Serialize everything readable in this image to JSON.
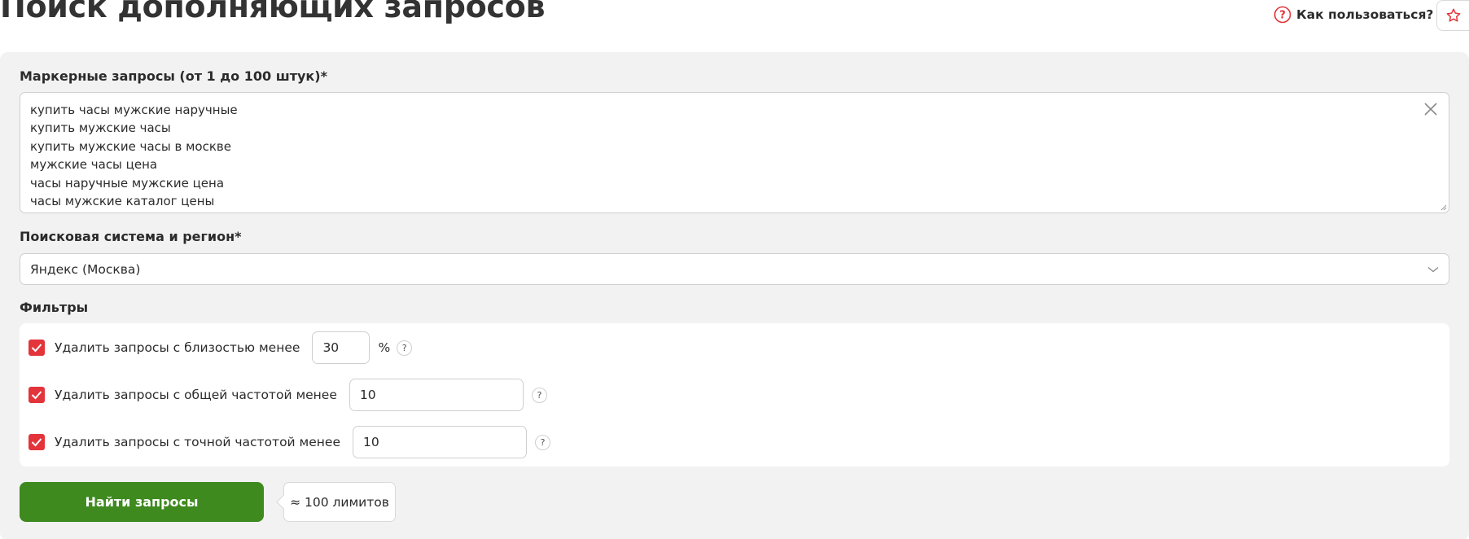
{
  "header": {
    "title": "Поиск дополняющих запросов",
    "help_label": "Как пользоваться?",
    "help_icon": "question-circle-icon",
    "favorite_icon": "star-icon",
    "accent_color": "#e3343b"
  },
  "form": {
    "queries_label": "Маркерные запросы (от 1 до 100 штук)*",
    "queries": [
      "купить часы мужские наручные",
      "купить мужские часы",
      "купить мужские часы в москве",
      "мужские часы цена",
      "часы наручные мужские цена",
      "часы мужские каталог цены"
    ],
    "engine_label": "Поисковая система и регион*",
    "engine_value": "Яндекс (Москва)",
    "filters_label": "Фильтры",
    "filters": [
      {
        "label": "Удалить запросы с близостью менее",
        "value": "30",
        "unit": "%",
        "checked": true
      },
      {
        "label": "Удалить запросы с общей частотой менее",
        "value": "10",
        "unit": "",
        "checked": true
      },
      {
        "label": "Удалить запросы с точной частотой менее",
        "value": "10",
        "unit": "",
        "checked": true
      }
    ],
    "info_mark": "?",
    "submit_label": "Найти запросы",
    "submit_color": "#3e8a1f",
    "limits_text": "≈ 100 лимитов"
  }
}
